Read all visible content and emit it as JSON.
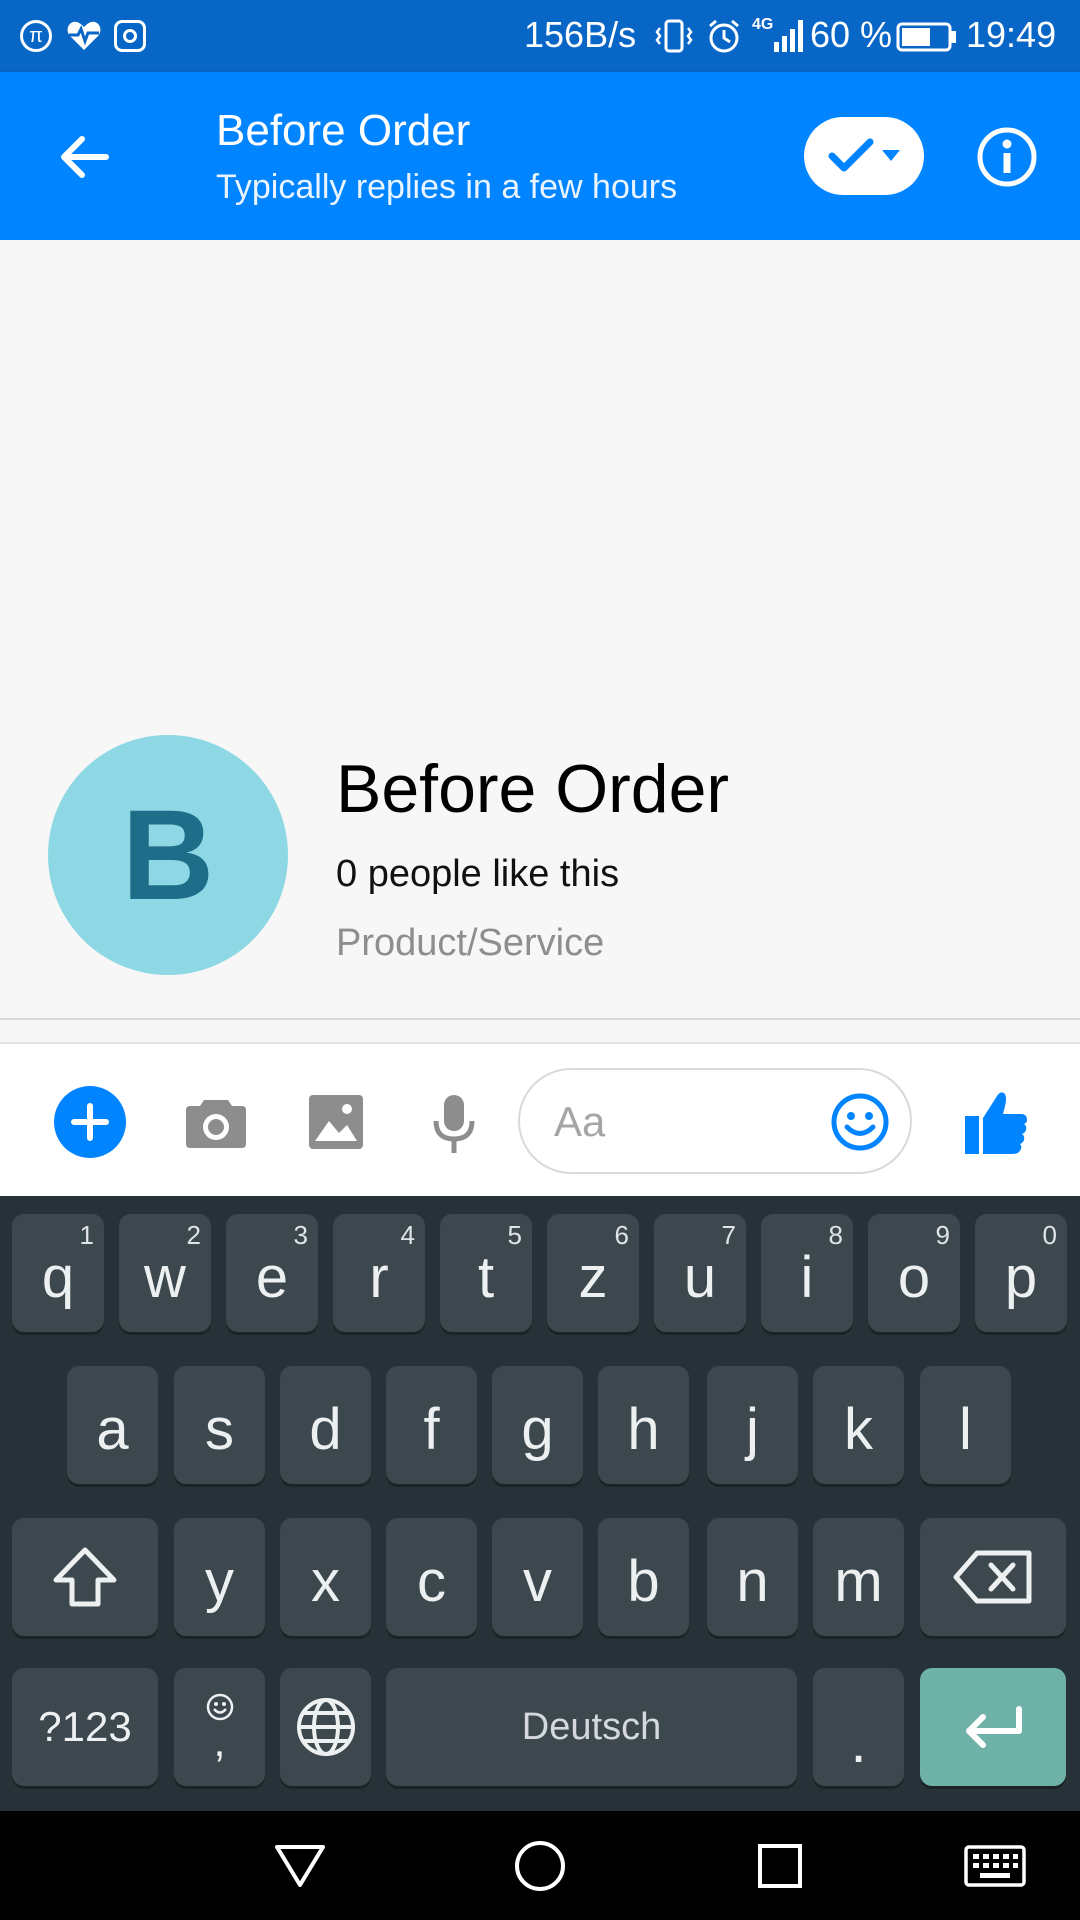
{
  "status_bar": {
    "left_icons": [
      "pi-icon",
      "heart-pulse-icon",
      "instagram-icon"
    ],
    "net_speed": "156B/s",
    "network": "4G",
    "battery": "60 %",
    "time": "19:49"
  },
  "header": {
    "title": "Before Order",
    "subtitle": "Typically replies in a few hours"
  },
  "profile": {
    "avatar_letter": "B",
    "name": "Before Order",
    "likes": "0 people like this",
    "category": "Product/Service"
  },
  "composer": {
    "placeholder": "Aa"
  },
  "keyboard": {
    "row1": [
      {
        "key": "q",
        "hint": "1"
      },
      {
        "key": "w",
        "hint": "2"
      },
      {
        "key": "e",
        "hint": "3"
      },
      {
        "key": "r",
        "hint": "4"
      },
      {
        "key": "t",
        "hint": "5"
      },
      {
        "key": "z",
        "hint": "6"
      },
      {
        "key": "u",
        "hint": "7"
      },
      {
        "key": "i",
        "hint": "8"
      },
      {
        "key": "o",
        "hint": "9"
      },
      {
        "key": "p",
        "hint": "0"
      }
    ],
    "row2": [
      "a",
      "s",
      "d",
      "f",
      "g",
      "h",
      "j",
      "k",
      "l"
    ],
    "row3": [
      "y",
      "x",
      "c",
      "v",
      "b",
      "n",
      "m"
    ],
    "symbols_label": "?123",
    "comma_label": ",",
    "space_label": "Deutsch",
    "period_label": "."
  },
  "colors": {
    "status_bar": "#0866c6",
    "app_bar": "#0084ff",
    "accent": "#0084ff",
    "avatar_bg": "#8dd8e4",
    "avatar_letter": "#1f6e89",
    "keyboard_bg": "#263238",
    "key_bg": "#3c474e",
    "enter_key": "#6db1a7"
  }
}
